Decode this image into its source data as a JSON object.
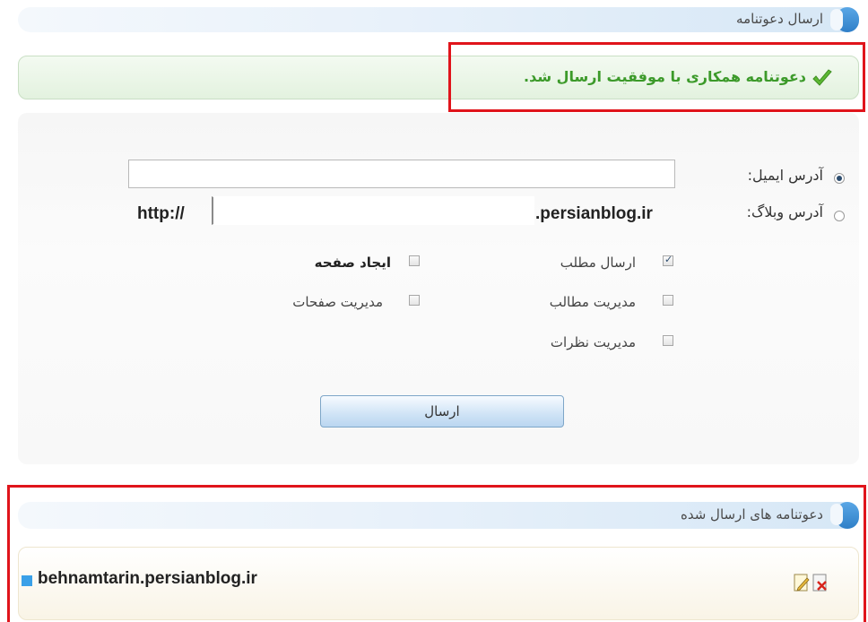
{
  "send_section": {
    "title": "ارسال دعوتنامه"
  },
  "success": {
    "message": "دعوتنامه همکاری با موفقیت ارسال شد.",
    "icon": "checkmark-icon",
    "color": "#3c9a2a"
  },
  "form": {
    "email_label": "آدرس ایمیل:",
    "email_value": "",
    "blog_label": "آدرس وبلاگ:",
    "blog_prefix": "http://",
    "blog_suffix": ".persianblog.ir",
    "blog_value": "",
    "selected_option": "email",
    "permissions": [
      {
        "label": "ارسال مطلب",
        "checked": true
      },
      {
        "label": "ایجاد صفحه",
        "checked": false
      },
      {
        "label": "مدیریت مطالب",
        "checked": false
      },
      {
        "label": "مدیریت صفحات",
        "checked": false
      },
      {
        "label": "مدیریت نظرات",
        "checked": false
      }
    ],
    "submit_label": "ارسال"
  },
  "sent_section": {
    "title": "دعوتنامه های ارسال شده",
    "items": [
      {
        "address": "behnamtarin.persianblog.ir"
      }
    ]
  },
  "colors": {
    "header_accent": "#2f7fc8",
    "highlight_border": "#e0141b"
  }
}
